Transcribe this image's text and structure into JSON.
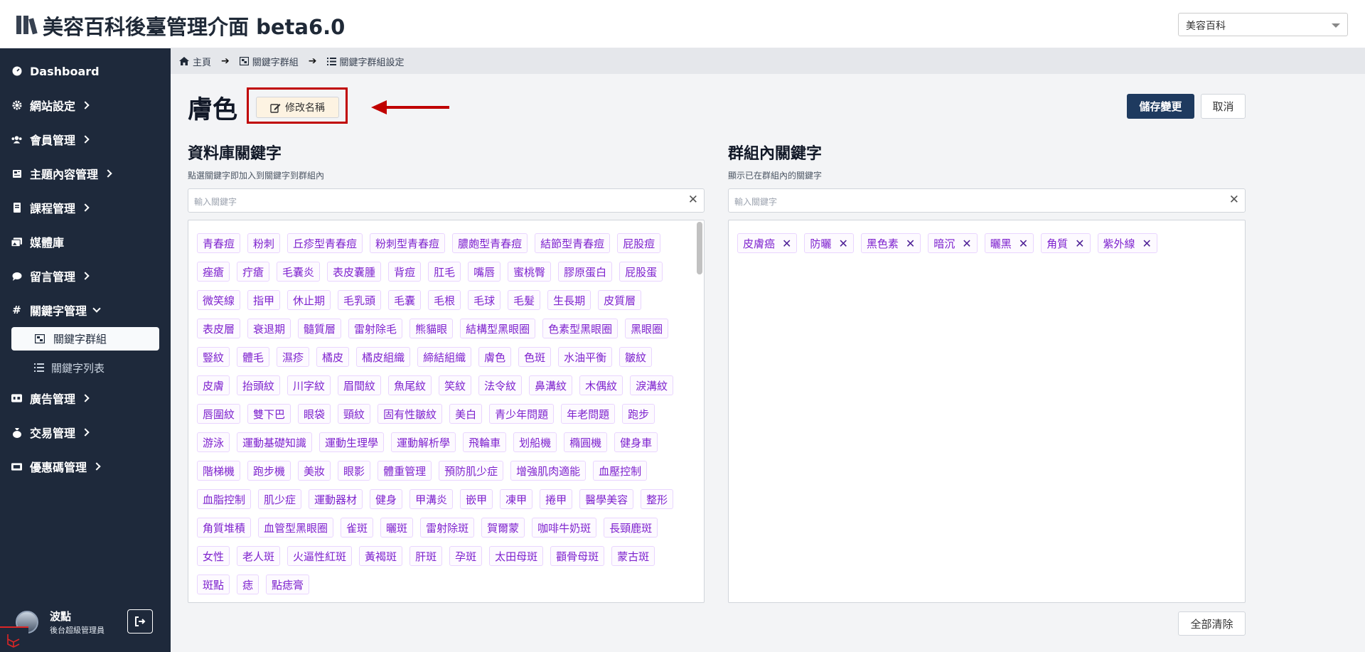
{
  "app": {
    "title": "美容百科後臺管理介面 beta6.0",
    "site_select": "美容百科"
  },
  "sidebar": {
    "items": [
      {
        "label": "Dashboard"
      },
      {
        "label": "網站設定"
      },
      {
        "label": "會員管理"
      },
      {
        "label": "主題內容管理"
      },
      {
        "label": "課程管理"
      },
      {
        "label": "媒體庫"
      },
      {
        "label": "留言管理"
      },
      {
        "label": "關鍵字管理"
      },
      {
        "label": "廣告管理"
      },
      {
        "label": "交易管理"
      },
      {
        "label": "優惠碼管理"
      }
    ],
    "sub_active": "關鍵字群組",
    "sub_item": "關鍵字列表",
    "user": {
      "name": "波點",
      "role": "後台超級管理員"
    }
  },
  "breadcrumb": {
    "home": "主頁",
    "group": "關鍵字群組",
    "settings": "關鍵字群組設定"
  },
  "page": {
    "title": "膚色",
    "rename_label": "修改名稱",
    "save_label": "儲存變更",
    "cancel_label": "取消",
    "clear_all_label": "全部清除"
  },
  "left": {
    "title": "資料庫關鍵字",
    "hint": "點選關鍵字即加入到關鍵字到群組內",
    "placeholder": "輸入關鍵字",
    "tags": [
      "青春痘",
      "粉刺",
      "丘疹型青春痘",
      "粉刺型青春痘",
      "膿皰型青春痘",
      "結節型青春痘",
      "屁股痘",
      "痤瘡",
      "疔瘡",
      "毛囊炎",
      "表皮囊腫",
      "背痘",
      "肛毛",
      "嘴唇",
      "蜜桃臀",
      "膠原蛋白",
      "屁股蛋",
      "微笑線",
      "指甲",
      "休止期",
      "毛乳頭",
      "毛囊",
      "毛根",
      "毛球",
      "毛髮",
      "生長期",
      "皮質層",
      "表皮層",
      "衰退期",
      "髓質層",
      "雷射除毛",
      "熊貓眼",
      "結構型黑眼圈",
      "色素型黑眼圈",
      "黑眼圈",
      "豎紋",
      "體毛",
      "濕疹",
      "橘皮",
      "橘皮組織",
      "締結組織",
      "膚色",
      "色斑",
      "水油平衡",
      "皺紋",
      "皮膚",
      "抬頭紋",
      "川字紋",
      "眉間紋",
      "魚尾紋",
      "笑紋",
      "法令紋",
      "鼻溝紋",
      "木偶紋",
      "淚溝紋",
      "唇圍紋",
      "雙下巴",
      "眼袋",
      "頸紋",
      "固有性皺紋",
      "美白",
      "青少年問題",
      "年老問題",
      "跑步",
      "游泳",
      "運動基礎知識",
      "運動生理學",
      "運動解析學",
      "飛輪車",
      "划船機",
      "橢圓機",
      "健身車",
      "階梯機",
      "跑步機",
      "美妝",
      "眼影",
      "體重管理",
      "預防肌少症",
      "增強肌肉適能",
      "血壓控制",
      "血脂控制",
      "肌少症",
      "運動器材",
      "健身",
      "甲溝炎",
      "嵌甲",
      "凍甲",
      "捲甲",
      "醫學美容",
      "整形",
      "角質堆積",
      "血管型黑眼圈",
      "雀斑",
      "曬斑",
      "雷射除斑",
      "賀爾蒙",
      "咖啡牛奶斑",
      "長頸鹿斑",
      "女性",
      "老人斑",
      "火逼性紅斑",
      "黃褐斑",
      "肝斑",
      "孕斑",
      "太田母斑",
      "顴骨母斑",
      "蒙古斑",
      "斑點",
      "痣",
      "點痣膏"
    ]
  },
  "right": {
    "title": "群組內關鍵字",
    "hint": "顯示已在群組內的關鍵字",
    "placeholder": "輸入關鍵字",
    "tags": [
      "皮膚癌",
      "防曬",
      "黑色素",
      "暗沉",
      "曬黑",
      "角質",
      "紫外線"
    ]
  },
  "colors": {
    "sidebar_bg": "#1e293b",
    "tag_text": "#7e22ce",
    "tag_border": "#e9d5ff",
    "save_bg": "#1e3a5f",
    "highlight": "#c00000"
  }
}
